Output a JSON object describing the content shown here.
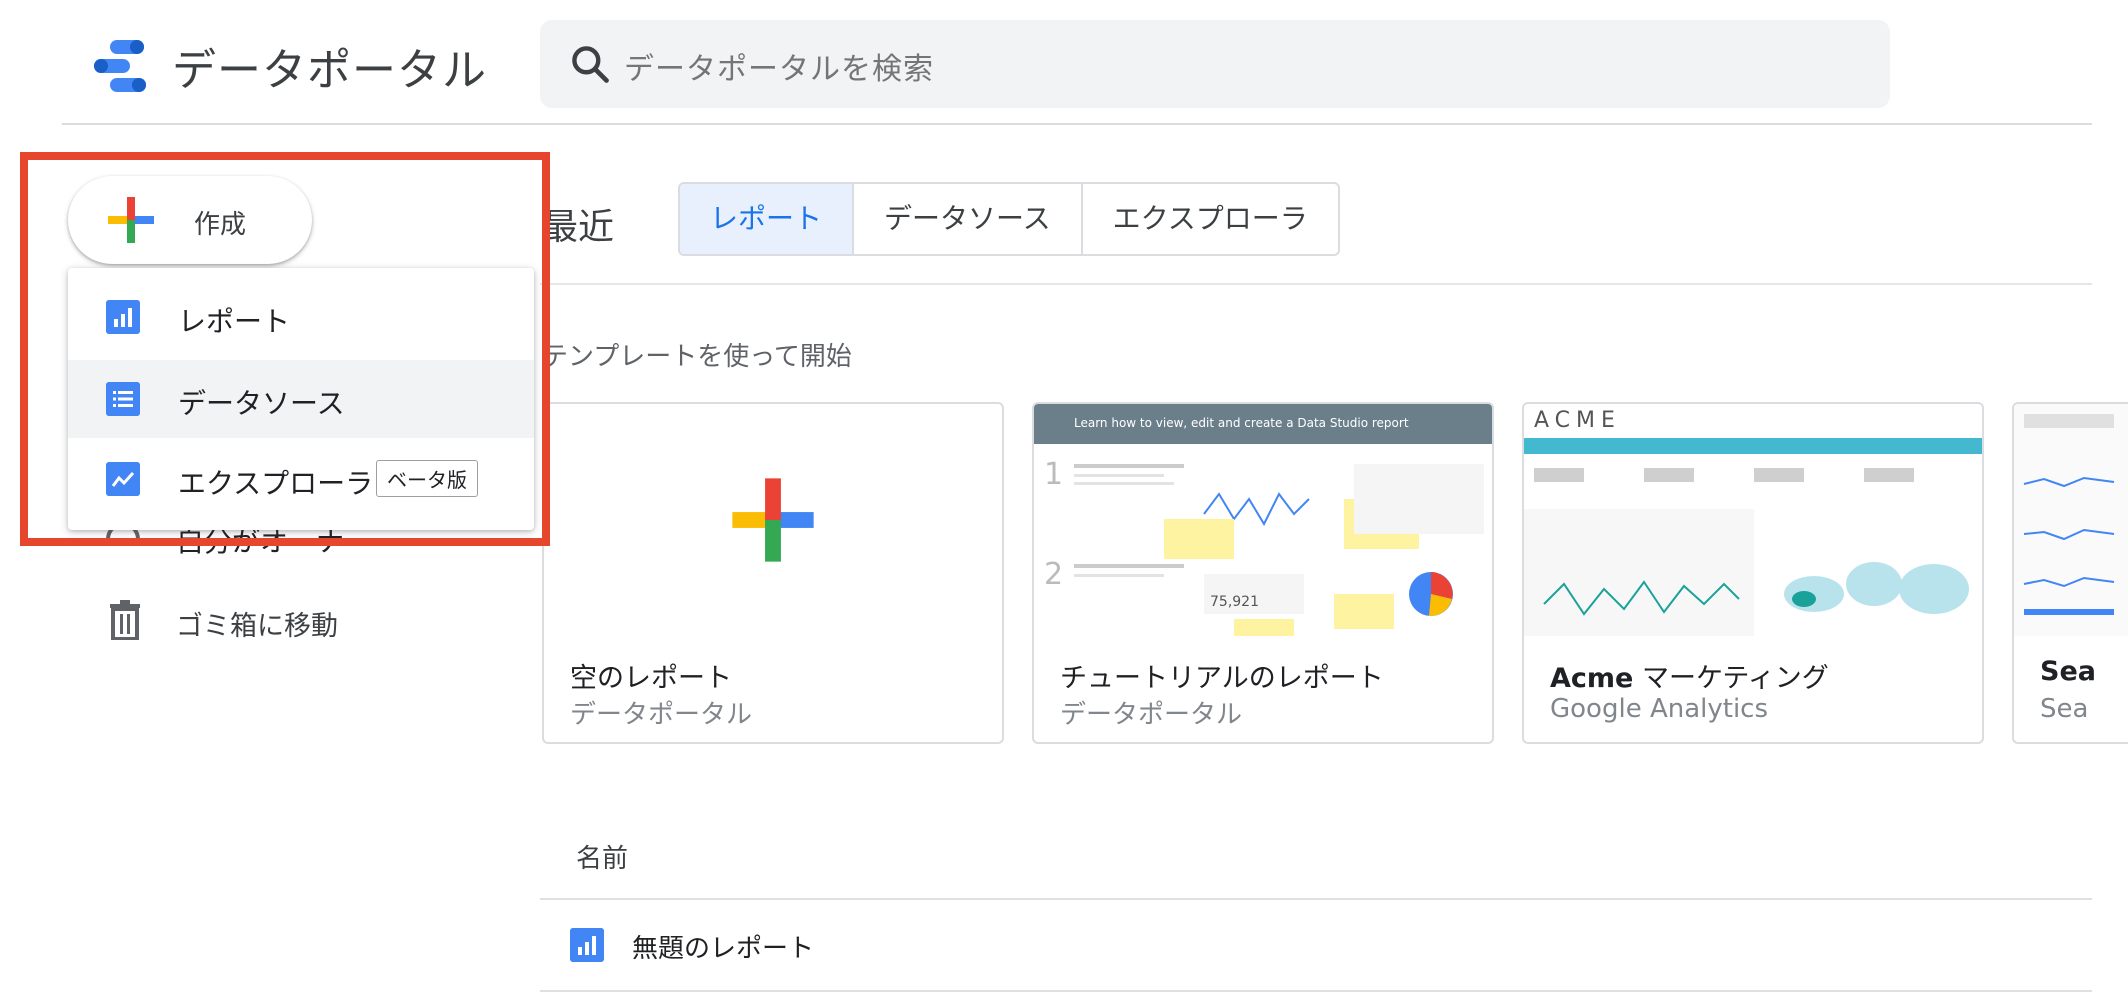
{
  "app": {
    "title": "データポータル"
  },
  "search": {
    "placeholder": "データポータルを検索"
  },
  "sidebar": {
    "create_label": "作成",
    "menu": [
      {
        "label": "レポート",
        "icon": "report-icon"
      },
      {
        "label": "データソース",
        "icon": "datasource-icon"
      },
      {
        "label": "エクスプローラ",
        "icon": "explorer-icon",
        "badge": "ベータ版"
      }
    ],
    "hidden_item_label": "自分がオーナー",
    "trash_label": "ゴミ箱に移動"
  },
  "main": {
    "recent_title": "最近",
    "tabs": [
      {
        "label": "レポート",
        "active": true
      },
      {
        "label": "データソース",
        "active": false
      },
      {
        "label": "エクスプローラ",
        "active": false
      }
    ],
    "templates_title": "テンプレートを使って開始",
    "templates": [
      {
        "title": "空のレポート",
        "subtitle": "データポータル"
      },
      {
        "title": "チュートリアルのレポート",
        "subtitle": "データポータル",
        "thumb_header": "Learn how to view, edit and create a Data Studio report"
      },
      {
        "title_bold": "Acme",
        "title_rest": " マーケティング",
        "subtitle": "Google Analytics",
        "logo": "ACME"
      },
      {
        "title": "Sea",
        "subtitle": "Sea"
      }
    ],
    "list": {
      "header": "名前",
      "rows": [
        {
          "label": "無題のレポート"
        }
      ]
    }
  },
  "colors": {
    "accent": "#1a73e8",
    "highlight": "#e5462d",
    "report_icon": "#4285f4"
  }
}
